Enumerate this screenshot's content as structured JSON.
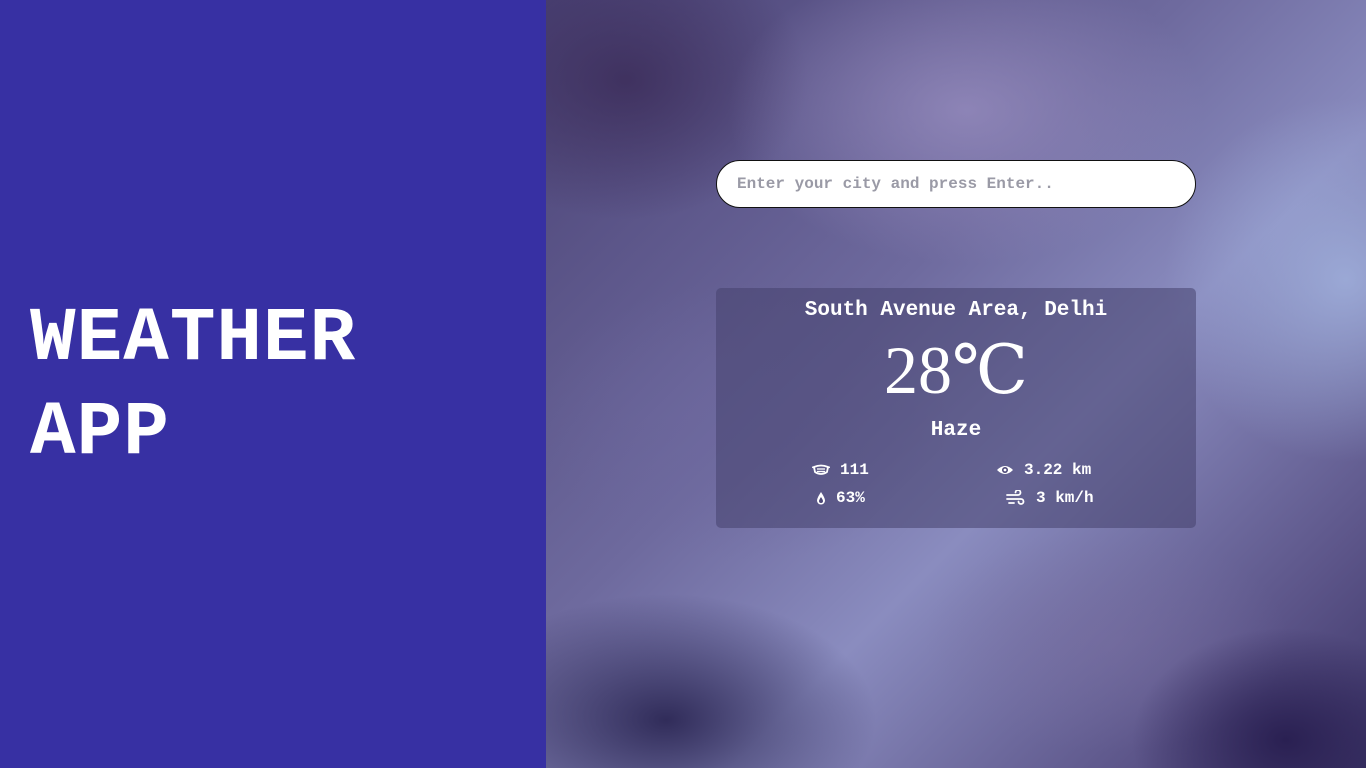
{
  "brand": {
    "title_line1": "WEATHER",
    "title_line2": "APP"
  },
  "search": {
    "placeholder": "Enter your city and press Enter..",
    "value": ""
  },
  "weather": {
    "location": "South Avenue Area, Delhi",
    "temperature": "28℃",
    "condition": "Haze",
    "stats": {
      "aqi": {
        "icon": "mask-icon",
        "value": "111"
      },
      "visibility": {
        "icon": "eye-icon",
        "value": "3.22 km"
      },
      "humidity": {
        "icon": "droplet-icon",
        "value": "63%"
      },
      "wind": {
        "icon": "wind-icon",
        "value": "3 km/h"
      }
    }
  },
  "colors": {
    "left_panel": "#3730a3",
    "text": "#ffffff"
  }
}
